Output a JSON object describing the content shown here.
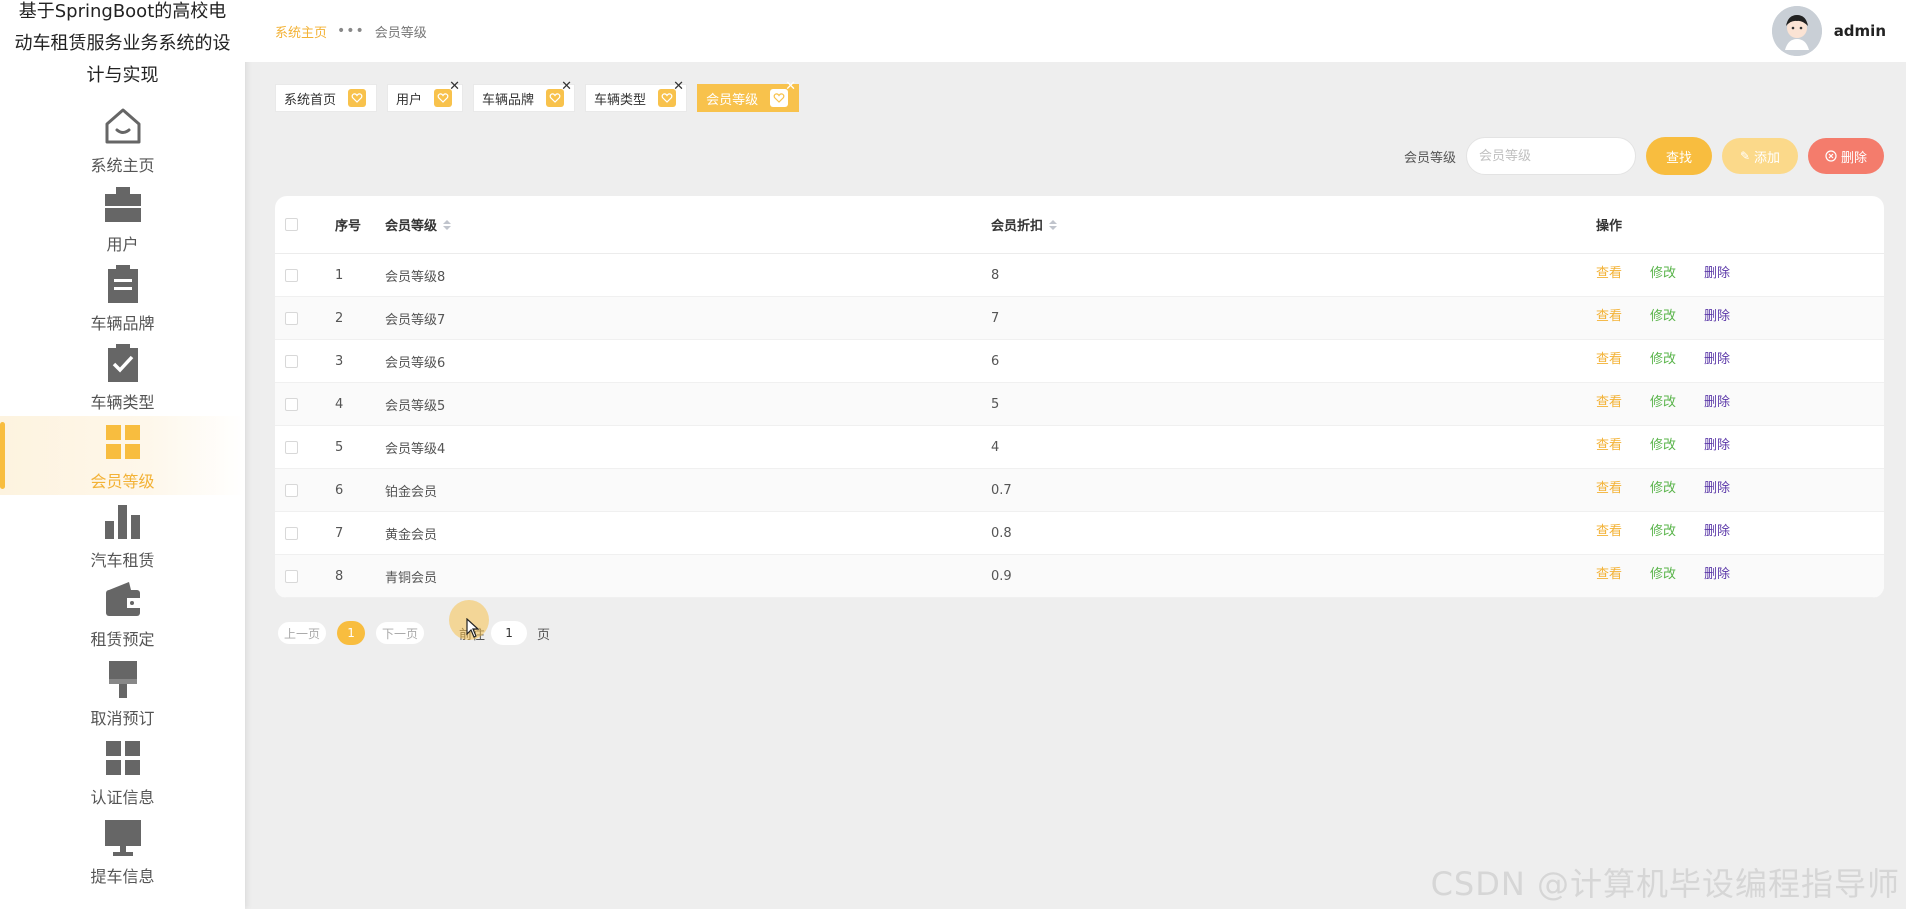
{
  "app": {
    "title": "基于SpringBoot的高校电动车租赁服务业务系统的设计与实现"
  },
  "sidebar": {
    "items": [
      {
        "label": "系统主页",
        "icon": "home-icon",
        "active": false
      },
      {
        "label": "用户",
        "icon": "briefcase-icon",
        "active": false
      },
      {
        "label": "车辆品牌",
        "icon": "clipboard-icon",
        "active": false
      },
      {
        "label": "车辆类型",
        "icon": "clipboard-check-icon",
        "active": false
      },
      {
        "label": "会员等级",
        "icon": "grid-icon",
        "active": true
      },
      {
        "label": "汽车租赁",
        "icon": "bar-chart-icon",
        "active": false
      },
      {
        "label": "租赁预定",
        "icon": "wallet-icon",
        "active": false
      },
      {
        "label": "取消预订",
        "icon": "brush-icon",
        "active": false
      },
      {
        "label": "认证信息",
        "icon": "grid-icon",
        "active": false
      },
      {
        "label": "提车信息",
        "icon": "monitor-icon",
        "active": false
      }
    ]
  },
  "header": {
    "breadcrumb_home": "系统主页",
    "breadcrumb_sep": "•••",
    "breadcrumb_current": "会员等级",
    "username": "admin"
  },
  "tags": [
    {
      "label": "系统首页",
      "closable": false,
      "active": false
    },
    {
      "label": "用户",
      "closable": true,
      "active": false
    },
    {
      "label": "车辆品牌",
      "closable": true,
      "active": false
    },
    {
      "label": "车辆类型",
      "closable": true,
      "active": false
    },
    {
      "label": "会员等级",
      "closable": true,
      "active": true
    }
  ],
  "search": {
    "label": "会员等级",
    "placeholder": "会员等级",
    "search_button": "查找",
    "add_button": "添加",
    "delete_button": "删除"
  },
  "table": {
    "headers": {
      "index": "序号",
      "level": "会员等级",
      "discount": "会员折扣",
      "ops": "操作"
    },
    "rows": [
      {
        "index": "1",
        "level": "会员等级8",
        "discount": "8"
      },
      {
        "index": "2",
        "level": "会员等级7",
        "discount": "7"
      },
      {
        "index": "3",
        "level": "会员等级6",
        "discount": "6"
      },
      {
        "index": "4",
        "level": "会员等级5",
        "discount": "5"
      },
      {
        "index": "5",
        "level": "会员等级4",
        "discount": "4"
      },
      {
        "index": "6",
        "level": "铂金会员",
        "discount": "0.7"
      },
      {
        "index": "7",
        "level": "黄金会员",
        "discount": "0.8"
      },
      {
        "index": "8",
        "level": "青铜会员",
        "discount": "0.9"
      }
    ],
    "op_view": "查看",
    "op_edit": "修改",
    "op_delete": "删除"
  },
  "pagination": {
    "prev": "上一页",
    "current": "1",
    "next": "下一页",
    "goto": "前往",
    "goto_value": "1",
    "suffix": "页"
  },
  "watermark": "CSDN @计算机毕设编程指导师",
  "colors": {
    "accent": "#f8bd3f",
    "view": "#f3b236",
    "edit": "#59b44a",
    "delete": "#5a37a8",
    "danger": "#f47c6c"
  }
}
